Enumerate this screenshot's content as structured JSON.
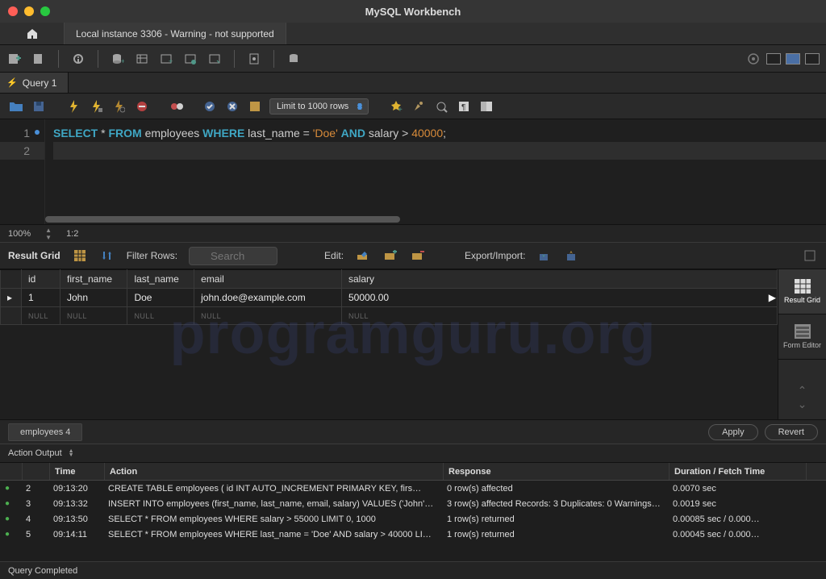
{
  "app": {
    "title": "MySQL Workbench"
  },
  "connection_tab": "Local instance 3306 - Warning - not supported",
  "query_tab": "Query 1",
  "limit_selector": "Limit to 1000 rows",
  "sql": {
    "tokens": [
      "SELECT",
      " * ",
      "FROM",
      " employees ",
      "WHERE",
      " last_name = ",
      "'Doe'",
      " ",
      "AND",
      " salary > ",
      "40000",
      ";"
    ]
  },
  "editor_status": {
    "zoom": "100%",
    "pos": "1:2"
  },
  "results_toolbar": {
    "title": "Result Grid",
    "filter_label": "Filter Rows:",
    "search_placeholder": "Search",
    "edit_label": "Edit:",
    "exportimport_label": "Export/Import:"
  },
  "side_panels": {
    "result_grid": "Result Grid",
    "form_editor": "Form Editor"
  },
  "columns": [
    "id",
    "first_name",
    "last_name",
    "email",
    "salary"
  ],
  "rows": [
    {
      "id": "1",
      "first_name": "John",
      "last_name": "Doe",
      "email": "john.doe@example.com",
      "salary": "50000.00"
    }
  ],
  "null_text": "NULL",
  "result_tab": "employees 4",
  "apply_label": "Apply",
  "revert_label": "Revert",
  "action_output_label": "Action Output",
  "ao_headers": {
    "time": "Time",
    "action": "Action",
    "response": "Response",
    "duration": "Duration / Fetch Time"
  },
  "ao_rows": [
    {
      "n": "2",
      "time": "09:13:20",
      "action": "CREATE TABLE employees (     id INT AUTO_INCREMENT PRIMARY KEY,     firs…",
      "response": "0 row(s) affected",
      "duration": "0.0070 sec"
    },
    {
      "n": "3",
      "time": "09:13:32",
      "action": "INSERT INTO employees (first_name, last_name, email, salary) VALUES ('John'…",
      "response": "3 row(s) affected Records: 3  Duplicates: 0  Warnings…",
      "duration": "0.0019 sec"
    },
    {
      "n": "4",
      "time": "09:13:50",
      "action": "SELECT * FROM employees WHERE salary > 55000 LIMIT 0, 1000",
      "response": "1 row(s) returned",
      "duration": "0.00085 sec / 0.000…"
    },
    {
      "n": "5",
      "time": "09:14:11",
      "action": "SELECT * FROM employees WHERE last_name = 'Doe' AND salary > 40000 LI…",
      "response": "1 row(s) returned",
      "duration": "0.00045 sec / 0.000…"
    }
  ],
  "status": "Query Completed",
  "watermark": "programguru.org"
}
